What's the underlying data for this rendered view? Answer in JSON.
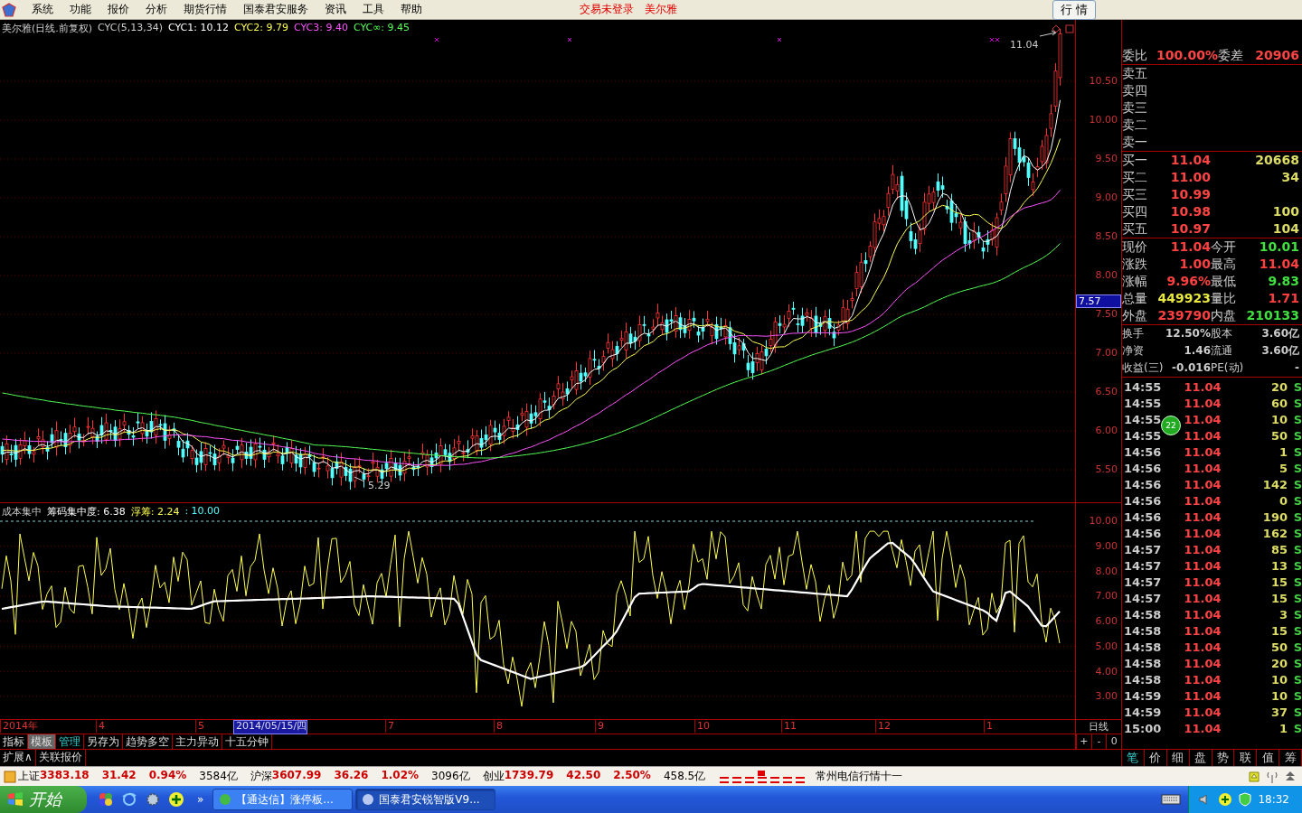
{
  "menubar": {
    "items": [
      "系统",
      "功能",
      "报价",
      "分析",
      "期货行情",
      "国泰君安服务",
      "资讯",
      "工具",
      "帮助"
    ],
    "login_status": "交易未登录",
    "stock_name": "美尔雅",
    "quote_button": "行 情"
  },
  "price_chart": {
    "title": "美尔雅(日线.前复权)",
    "indicator": "CYC(5,13,34)",
    "legend": [
      {
        "label": "CYC1: 10.12",
        "color": "#ffffff"
      },
      {
        "label": "CYC2: 9.79",
        "color": "#ffff54"
      },
      {
        "label": "CYC3: 9.40",
        "color": "#ff54ff"
      },
      {
        "label": "CYC∞: 9.45",
        "color": "#54ff54"
      }
    ],
    "high_label": "11.04",
    "low_label": "5.29",
    "y_axis": [
      "10.50",
      "10.00",
      "9.50",
      "9.00",
      "8.50",
      "8.00",
      "7.50",
      "7.00",
      "6.50",
      "6.00",
      "5.50"
    ],
    "cursor_price": "7.57"
  },
  "indicator_pane": {
    "name": "成本集中",
    "legend": [
      {
        "label": "筹码集中度: 6.38",
        "color": "#ffffff"
      },
      {
        "label": "浮筹: 2.24",
        "color": "#ffff54"
      },
      {
        "label": ": 10.00",
        "color": "#54ffff"
      }
    ],
    "y_axis": [
      "10.00",
      "9.00",
      "8.00",
      "7.00",
      "6.00",
      "5.00",
      "4.00",
      "3.00"
    ]
  },
  "date_axis": {
    "labels": [
      {
        "label": "2014年",
        "selected": false
      },
      {
        "label": "4",
        "selected": false
      },
      {
        "label": "5",
        "selected": false
      },
      {
        "label": "2014/05/15/四",
        "selected": true
      },
      {
        "label": "7",
        "selected": false
      },
      {
        "label": "8",
        "selected": false
      },
      {
        "label": "9",
        "selected": false
      },
      {
        "label": "10",
        "selected": false
      },
      {
        "label": "11",
        "selected": false
      },
      {
        "label": "12",
        "selected": false
      },
      {
        "label": "1",
        "selected": false
      }
    ],
    "period": "日线",
    "zoom_buttons": [
      "+",
      "-",
      "0"
    ]
  },
  "tabs": [
    {
      "label": "指标",
      "kind": "plain"
    },
    {
      "label": "模板",
      "kind": "pressed"
    },
    {
      "label": "管理",
      "kind": "accent"
    },
    {
      "label": "另存为",
      "kind": "plain"
    },
    {
      "label": "趋势多空",
      "kind": "plain"
    },
    {
      "label": "主力异动",
      "kind": "plain"
    },
    {
      "label": "十五分钟",
      "kind": "plain"
    }
  ],
  "sub_tabs": [
    "扩展∧",
    "关联报价"
  ],
  "quote_panel": {
    "ratio": {
      "label": "委比",
      "value": "100.00%",
      "label2": "委差",
      "value2": "20906"
    },
    "asks": [
      "卖五",
      "卖四",
      "卖三",
      "卖二",
      "卖一"
    ],
    "bids": [
      {
        "label": "买一",
        "price": "11.04",
        "volume": "20668"
      },
      {
        "label": "买二",
        "price": "11.00",
        "volume": "34"
      },
      {
        "label": "买三",
        "price": "10.99"
      },
      {
        "label": "买四",
        "price": "10.98",
        "volume": "100"
      },
      {
        "label": "买五",
        "price": "10.97",
        "volume": "104"
      }
    ],
    "stats": [
      {
        "label": "现价",
        "value": "11.04",
        "color": "#ff4040"
      },
      {
        "label": "今开",
        "value": "10.01",
        "color": "#40e040"
      },
      {
        "label": "涨跌",
        "value": "1.00",
        "color": "#ff4040"
      },
      {
        "label": "最高",
        "value": "11.04",
        "color": "#ff4040"
      },
      {
        "label": "涨幅",
        "value": "9.96%",
        "color": "#ff4040"
      },
      {
        "label": "最低",
        "value": "9.83",
        "color": "#40e040"
      },
      {
        "label": "总量",
        "value": "449923",
        "color": "#e8e840"
      },
      {
        "label": "量比",
        "value": "1.71",
        "color": "#ff4040"
      },
      {
        "label": "外盘",
        "value": "239790",
        "color": "#ff4040"
      },
      {
        "label": "内盘",
        "value": "210133",
        "color": "#40e040"
      }
    ],
    "finance": [
      {
        "label": "换手",
        "value": "12.50%"
      },
      {
        "label": "股本",
        "value": "3.60亿"
      },
      {
        "label": "净资",
        "value": "1.46"
      },
      {
        "label": "流通",
        "value": "3.60亿"
      },
      {
        "label": "收益(三)",
        "value": "-0.016"
      },
      {
        "label": "PE(动)",
        "value": "-"
      }
    ],
    "ticks": [
      {
        "time": "14:55",
        "price": "11.04",
        "volume": "20",
        "side": "S"
      },
      {
        "time": "14:55",
        "price": "11.04",
        "volume": "60",
        "side": "S"
      },
      {
        "time": "14:55",
        "price": "11.04",
        "volume": "10",
        "side": "S"
      },
      {
        "time": "14:55",
        "price": "11.04",
        "volume": "50",
        "side": "S"
      },
      {
        "time": "14:56",
        "price": "11.04",
        "volume": "1",
        "side": "S"
      },
      {
        "time": "14:56",
        "price": "11.04",
        "volume": "5",
        "side": "S"
      },
      {
        "time": "14:56",
        "price": "11.04",
        "volume": "142",
        "side": "S"
      },
      {
        "time": "14:56",
        "price": "11.04",
        "volume": "0",
        "side": "S"
      },
      {
        "time": "14:56",
        "price": "11.04",
        "volume": "190",
        "side": "S"
      },
      {
        "time": "14:56",
        "price": "11.04",
        "volume": "162",
        "side": "S"
      },
      {
        "time": "14:57",
        "price": "11.04",
        "volume": "85",
        "side": "S"
      },
      {
        "time": "14:57",
        "price": "11.04",
        "volume": "13",
        "side": "S"
      },
      {
        "time": "14:57",
        "price": "11.04",
        "volume": "15",
        "side": "S"
      },
      {
        "time": "14:57",
        "price": "11.04",
        "volume": "15",
        "side": "S"
      },
      {
        "time": "14:58",
        "price": "11.04",
        "volume": "3",
        "side": "S"
      },
      {
        "time": "14:58",
        "price": "11.04",
        "volume": "15",
        "side": "S"
      },
      {
        "time": "14:58",
        "price": "11.04",
        "volume": "50",
        "side": "S"
      },
      {
        "time": "14:58",
        "price": "11.04",
        "volume": "20",
        "side": "S"
      },
      {
        "time": "14:58",
        "price": "11.04",
        "volume": "10",
        "side": "S"
      },
      {
        "time": "14:59",
        "price": "11.04",
        "volume": "10",
        "side": "S"
      },
      {
        "time": "14:59",
        "price": "11.04",
        "volume": "37",
        "side": "S"
      },
      {
        "time": "15:00",
        "price": "11.04",
        "volume": "1",
        "side": "S"
      }
    ],
    "badge": "22",
    "tabs": [
      {
        "label": "笔",
        "selected": true
      },
      {
        "label": "价",
        "selected": false
      },
      {
        "label": "细",
        "selected": false
      },
      {
        "label": "盘",
        "selected": false
      },
      {
        "label": "势",
        "selected": false
      },
      {
        "label": "联",
        "selected": false
      },
      {
        "label": "值",
        "selected": false
      },
      {
        "label": "筹",
        "selected": false
      }
    ]
  },
  "index_bar": {
    "indices": [
      {
        "name": "上证",
        "value": "3383.18",
        "change": "31.42",
        "percent": "0.94%",
        "turnover": "3584亿"
      },
      {
        "name": "沪深",
        "value": "3607.99",
        "change": "36.26",
        "percent": "1.02%",
        "turnover": "3096亿"
      },
      {
        "name": "创业",
        "value": "1739.79",
        "change": "42.50",
        "percent": "2.50%",
        "turnover": "458.5亿"
      }
    ],
    "message": "常州电信行情十一"
  },
  "taskbar": {
    "start": "开始",
    "quicklaunch_more": "»",
    "windows": [
      {
        "title": "【通达信】涨停板...",
        "selected": false
      },
      {
        "title": "国泰君安锐智版V9...",
        "selected": true
      }
    ],
    "clock": "18:32"
  }
}
